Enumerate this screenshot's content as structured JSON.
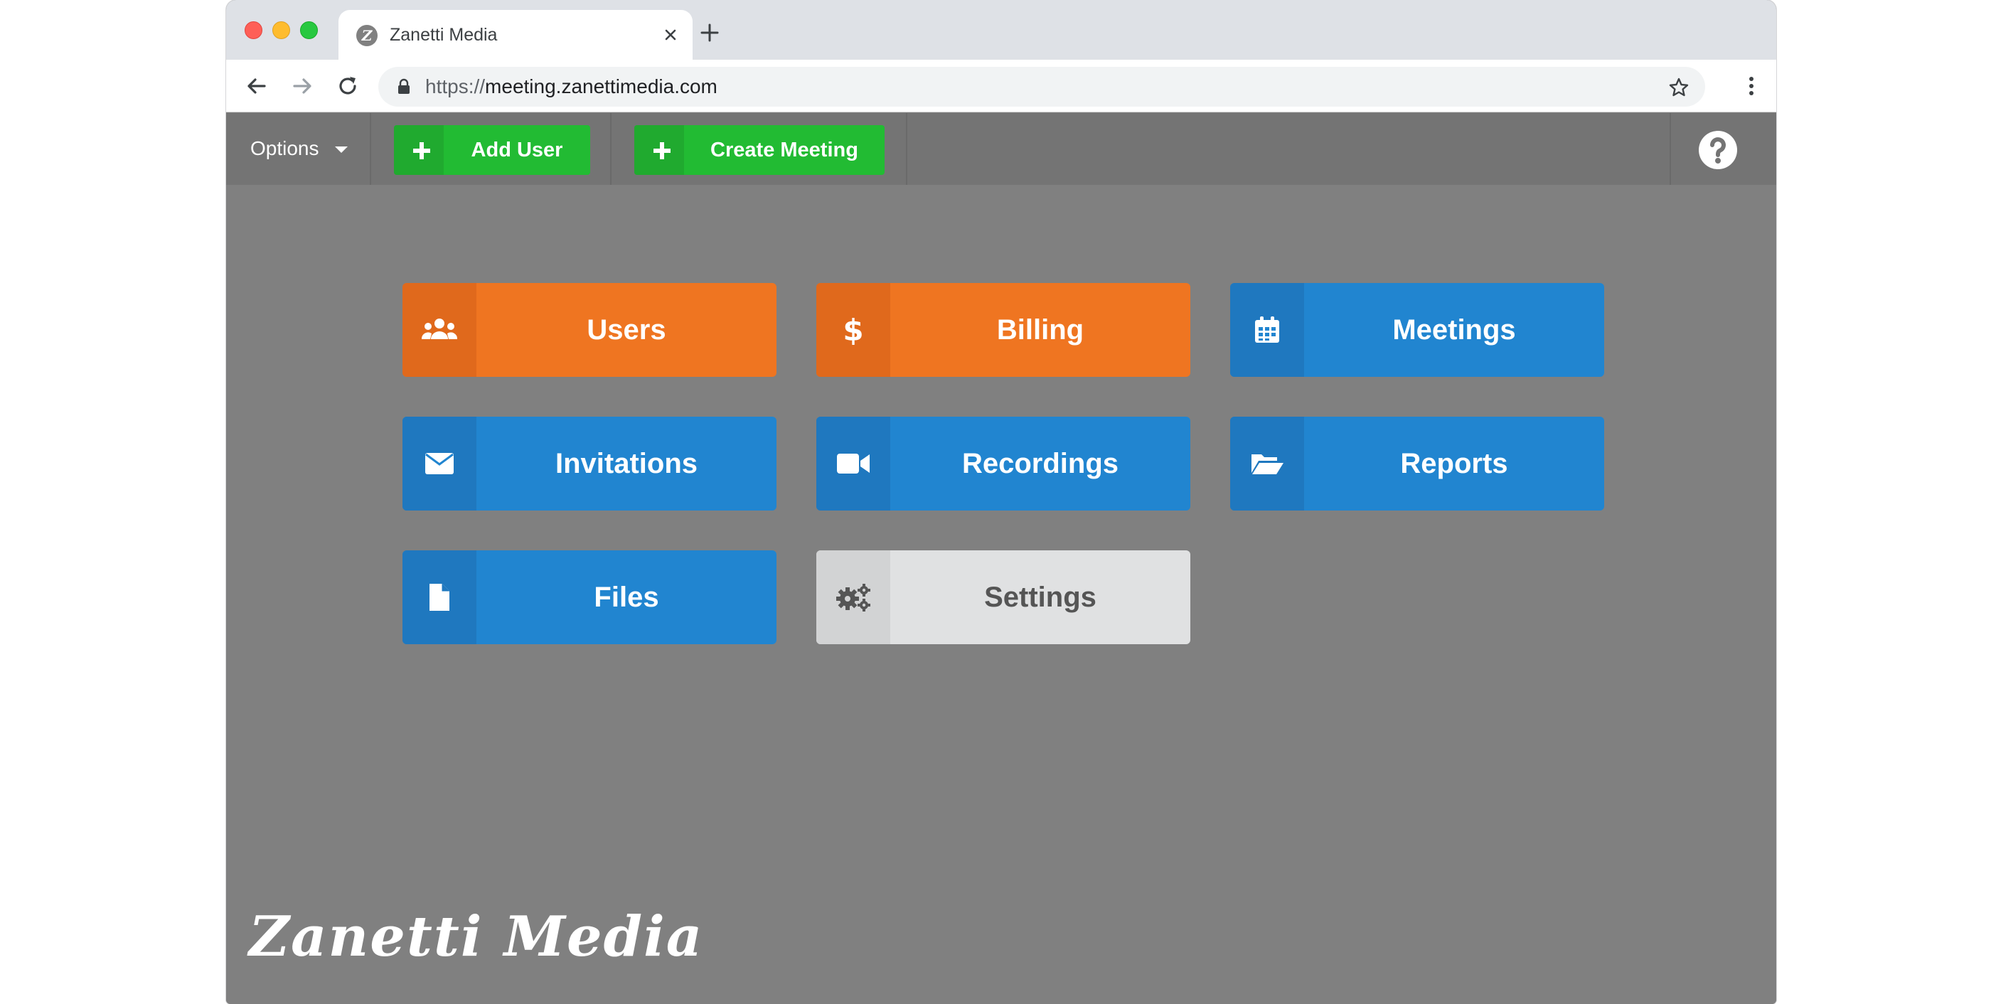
{
  "browser": {
    "tab_title": "Zanetti Media",
    "url_scheme": "https://",
    "url_host": "meeting.zanettimedia.com"
  },
  "appbar": {
    "options_label": "Options",
    "add_user_label": "Add User",
    "create_meeting_label": "Create Meeting",
    "help_icon": "question-circle-icon"
  },
  "tiles": [
    {
      "label": "Users",
      "icon": "users-icon",
      "color": "#ef7521"
    },
    {
      "label": "Billing",
      "icon": "dollar-icon",
      "color": "#ef7521"
    },
    {
      "label": "Meetings",
      "icon": "calendar-icon",
      "color": "#2185d0"
    },
    {
      "label": "Invitations",
      "icon": "envelope-icon",
      "color": "#2185d0"
    },
    {
      "label": "Recordings",
      "icon": "video-camera-icon",
      "color": "#2185d0"
    },
    {
      "label": "Reports",
      "icon": "folder-open-icon",
      "color": "#2185d0"
    },
    {
      "label": "Files",
      "icon": "file-icon",
      "color": "#2185d0"
    },
    {
      "label": "Settings",
      "icon": "gears-icon",
      "color": "#e0e1e2"
    }
  ],
  "footer": {
    "logo_text": "Zanetti Media"
  },
  "colors": {
    "green": "#22bb33",
    "orange": "#ef7521",
    "blue": "#2185d0",
    "background": "#808080"
  }
}
